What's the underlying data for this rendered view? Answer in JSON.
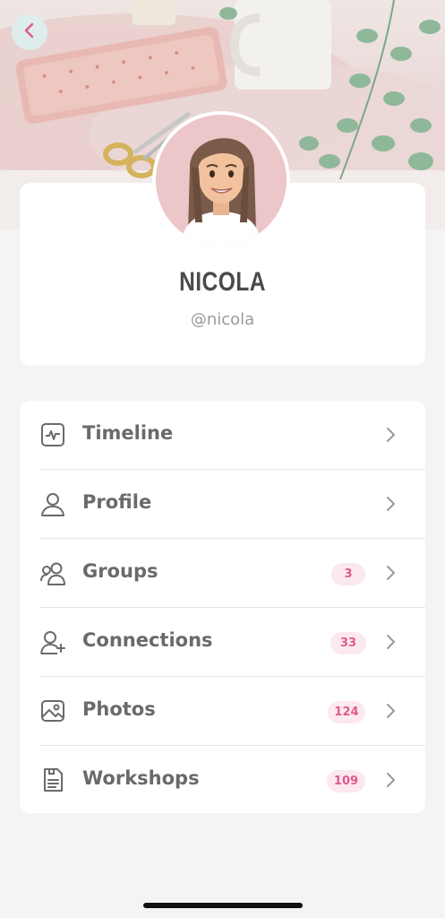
{
  "header": {
    "back_icon": "chevron-left-icon",
    "accent_color": "#e05a8c"
  },
  "profile": {
    "name": "NICOLA",
    "handle": "@nicola"
  },
  "menu": [
    {
      "label": "Timeline",
      "icon": "activity-icon",
      "badge": null
    },
    {
      "label": "Profile",
      "icon": "user-icon",
      "badge": null
    },
    {
      "label": "Groups",
      "icon": "users-icon",
      "badge": "3"
    },
    {
      "label": "Connections",
      "icon": "user-plus-icon",
      "badge": "33"
    },
    {
      "label": "Photos",
      "icon": "image-icon",
      "badge": "124"
    },
    {
      "label": "Workshops",
      "icon": "document-icon",
      "badge": "109"
    }
  ]
}
